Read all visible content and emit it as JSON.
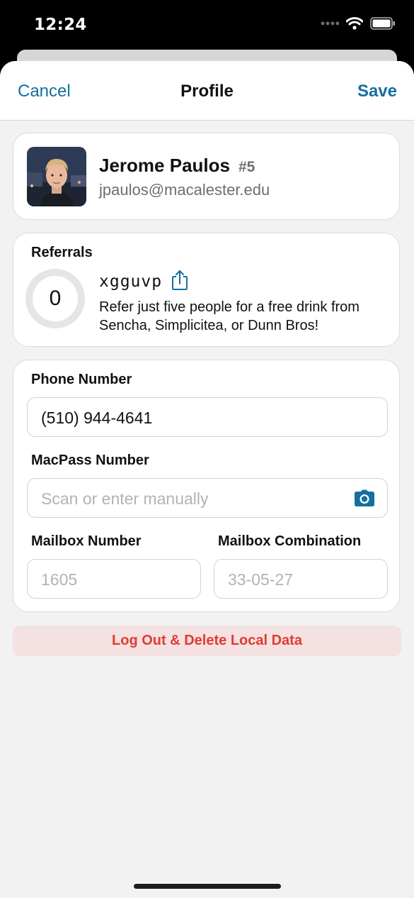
{
  "status": {
    "time": "12:24",
    "signal_icon": "signal-icon",
    "wifi_icon": "wifi-icon",
    "battery_icon": "battery-icon"
  },
  "nav": {
    "cancel_label": "Cancel",
    "title": "Profile",
    "save_label": "Save"
  },
  "profile": {
    "name": "Jerome Paulos",
    "rank": "#5",
    "email": "jpaulos@macalester.edu"
  },
  "referrals": {
    "title": "Referrals",
    "count": "0",
    "code": "xgguvp",
    "description": "Refer just five people for a free drink from Sencha, Simplicitea, or Dunn Bros!"
  },
  "form": {
    "phone_label": "Phone Number",
    "phone_value": "(510) 944-4641",
    "macpass_label": "MacPass Number",
    "macpass_placeholder": "Scan or enter manually",
    "mailbox_label": "Mailbox Number",
    "mailbox_placeholder": "1605",
    "combination_label": "Mailbox Combination",
    "combination_placeholder": "33-05-27"
  },
  "logout_label": "Log Out & Delete Local Data",
  "colors": {
    "accent": "#156fa0",
    "destructive": "#e13b31",
    "destructive_bg": "#f4e1e2",
    "background": "#f2f2f2"
  }
}
